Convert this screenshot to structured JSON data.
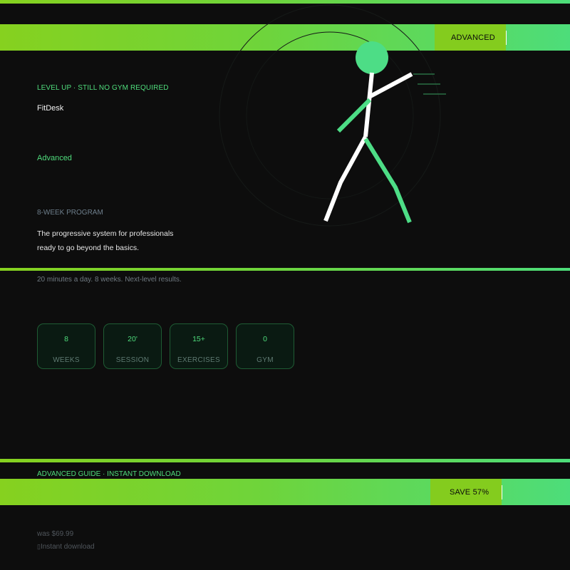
{
  "header": {
    "badge_label": "ADVANCED"
  },
  "hero": {
    "eyebrow": "LEVEL UP · STILL NO GYM REQUIRED",
    "brand": "FitDesk",
    "level": "Advanced",
    "program_label": "8-WEEK PROGRAM",
    "description_line1": "The progressive system for professionals",
    "description_line2": "ready to go beyond the basics.",
    "tagline": "20 minutes a day. 8 weeks. Next-level results."
  },
  "stats": [
    {
      "value": "8",
      "label": "WEEKS"
    },
    {
      "value": "20'",
      "label": "SESSION"
    },
    {
      "value": "15+",
      "label": "EXERCISES"
    },
    {
      "value": "0",
      "label": "GYM"
    }
  ],
  "footer": {
    "guide_label": "ADVANCED GUIDE · INSTANT DOWNLOAD",
    "save_badge": "SAVE 57%",
    "was_price": "was $69.99",
    "instant_glyph": "▯",
    "instant_download": "Instant download"
  },
  "colors": {
    "accent_green": "#4fdc7c",
    "accent_lime": "#86d11f",
    "background": "#0d0d0d"
  },
  "icons": {
    "hero_figure": "running-stick-figure-icon"
  }
}
